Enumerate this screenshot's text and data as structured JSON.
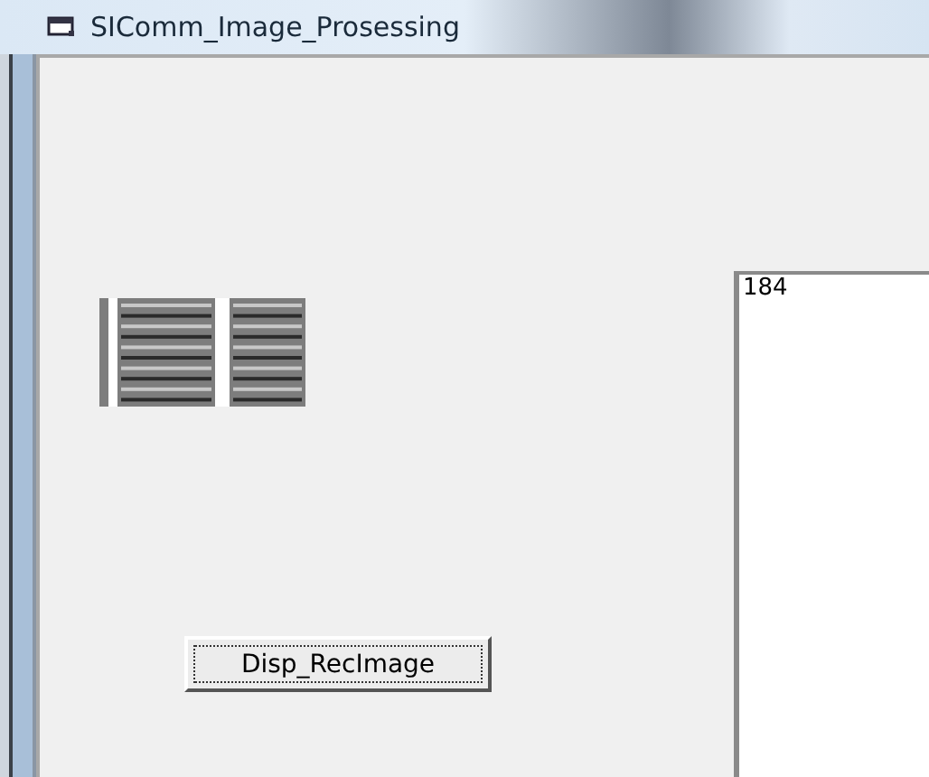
{
  "window": {
    "title": "SIComm_Image_Prosessing"
  },
  "text_box": {
    "value": "184"
  },
  "buttons": [
    {
      "label": "Disp_RecImage"
    }
  ]
}
